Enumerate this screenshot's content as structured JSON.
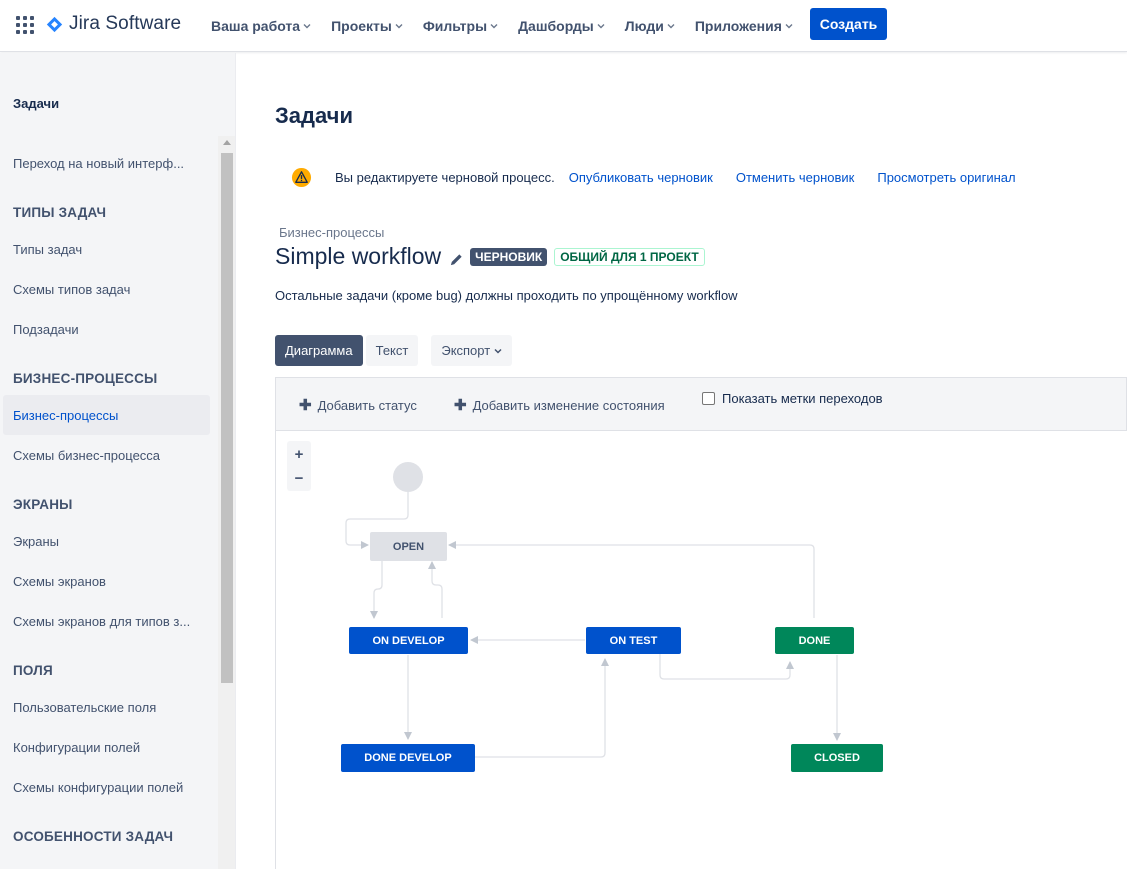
{
  "topnav": {
    "logo_text": "Jira Software",
    "brand_color": "#2684ff",
    "menu": [
      "Ваша работа",
      "Проекты",
      "Фильтры",
      "Дашборды",
      "Люди",
      "Приложения"
    ],
    "create_label": "Создать"
  },
  "sidebar": {
    "header": "Задачи",
    "items": {
      "new_ui": "Переход на новый интерф...",
      "types_heading": "ТИПЫ ЗАДАЧ",
      "issue_types": "Типы задач",
      "issue_type_schemes": "Схемы типов задач",
      "subtasks": "Подзадачи",
      "workflows_heading": "БИЗНЕС-ПРОЦЕССЫ",
      "workflows": "Бизнес-процессы",
      "workflow_schemes": "Схемы бизнес-процесса",
      "screens_heading": "ЭКРАНЫ",
      "screens": "Экраны",
      "screen_schemes": "Схемы экранов",
      "issue_type_screen_schemes": "Схемы экранов для типов з...",
      "fields_heading": "ПОЛЯ",
      "custom_fields": "Пользовательские поля",
      "field_configs": "Конфигурации полей",
      "field_config_schemes": "Схемы конфигурации полей",
      "features_heading": "ОСОБЕННОСТИ ЗАДАЧ"
    }
  },
  "main": {
    "title": "Задачи",
    "warning": {
      "text": "Вы редактируете черновой процесс.",
      "publish": "Опубликовать черновик",
      "discard": "Отменить черновик",
      "view_original": "Просмотреть оригинал"
    },
    "breadcrumb": "Бизнес-процессы",
    "workflow_name": "Simple workflow",
    "draft_badge": "ЧЕРНОВИК",
    "shared_badge": "ОБЩИЙ ДЛЯ 1 ПРОЕКТ",
    "description": "Остальные задачи (кроме bug) должны проходить по упрощённому workflow",
    "tabs": {
      "diagram": "Диаграмма",
      "text": "Текст",
      "export": "Экспорт"
    },
    "toolbar": {
      "add_status": "Добавить статус",
      "add_transition": "Добавить изменение состояния",
      "show_labels": "Показать метки переходов"
    },
    "zoom": {
      "in": "+",
      "out": "−"
    },
    "statuses": {
      "open": "OPEN",
      "on_develop": "ON DEVELOP",
      "on_test": "ON TEST",
      "done": "DONE",
      "done_develop": "DONE DEVELOP",
      "closed": "CLOSED"
    }
  },
  "colors": {
    "primary": "#0052cc",
    "success": "#00875a",
    "neutral": "#dfe1e6"
  }
}
